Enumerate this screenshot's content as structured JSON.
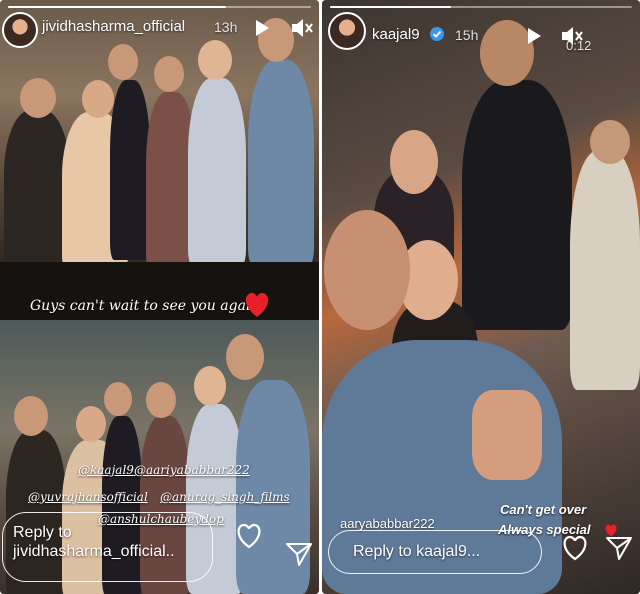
{
  "left_story": {
    "username": "jividhasharma_official",
    "timestamp": "13h",
    "overlay_text": "Guys can't wait to see you again",
    "emoji": "❤️",
    "mentions": [
      "@kaajal9",
      "@aariyababbar222",
      "@yuvrajhansofficial",
      "@anurag_singh_films",
      "@anshulchaubeydop"
    ],
    "reply_label": "Reply to",
    "reply_target": "jividhasharma_official.."
  },
  "right_story": {
    "username": "kaajal9",
    "verified": true,
    "timestamp": "15h",
    "video_time": "0:12",
    "mention": "aaryababbar222",
    "caption_line1": "Can't get over",
    "caption_line2": "Always special",
    "emoji": "❤️",
    "reply_placeholder": "Reply to kaajal9..."
  },
  "icons": {
    "play": "play-icon",
    "mute": "muted-speaker-icon",
    "like": "heart-icon",
    "share": "send-icon",
    "verified": "verified-badge-icon"
  },
  "colors": {
    "heart_red": "#e8202a",
    "verified_blue": "#3897f0"
  }
}
